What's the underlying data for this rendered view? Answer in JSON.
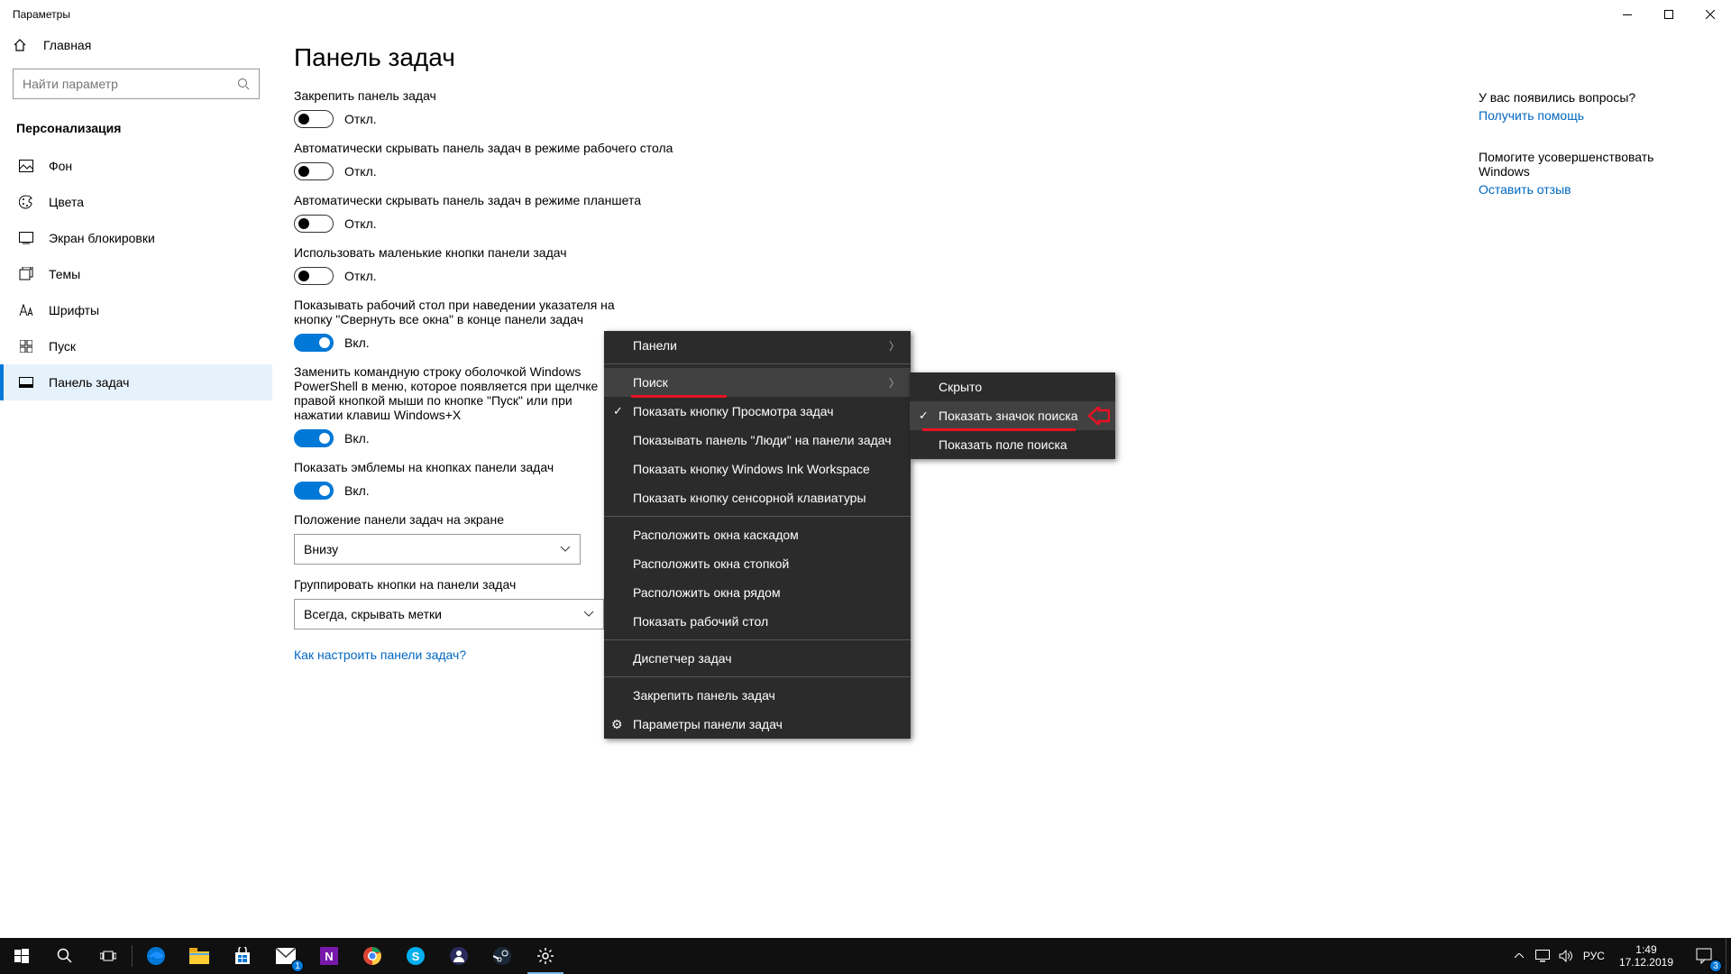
{
  "window": {
    "title": "Параметры"
  },
  "nav": {
    "home": "Главная",
    "search_placeholder": "Найти параметр",
    "section": "Персонализация",
    "items": [
      "Фон",
      "Цвета",
      "Экран блокировки",
      "Темы",
      "Шрифты",
      "Пуск",
      "Панель задач"
    ]
  },
  "page": {
    "title": "Панель задач",
    "off": "Откл.",
    "on": "Вкл.",
    "settings": [
      {
        "label": "Закрепить панель задач",
        "state": "off"
      },
      {
        "label": "Автоматически скрывать панель задач в режиме рабочего стола",
        "state": "off"
      },
      {
        "label": "Автоматически скрывать панель задач в режиме планшета",
        "state": "off"
      },
      {
        "label": "Использовать маленькие кнопки панели задач",
        "state": "off"
      },
      {
        "label": "Показывать рабочий стол при наведении указателя на кнопку \"Свернуть все окна\" в конце панели задач",
        "state": "on"
      },
      {
        "label": "Заменить командную строку оболочкой Windows PowerShell в меню, которое появляется при щелчке правой кнопкой мыши по кнопке \"Пуск\" или при нажатии клавиш Windows+X",
        "state": "on"
      },
      {
        "label": "Показать эмблемы на кнопках панели задач",
        "state": "on"
      }
    ],
    "position_label": "Положение панели задач на экране",
    "position_value": "Внизу",
    "group_label": "Группировать кнопки на панели задач",
    "group_value": "Всегда, скрывать метки",
    "help_link": "Как настроить панели задач?"
  },
  "rightcol": {
    "q1": "У вас появились вопросы?",
    "a1": "Получить помощь",
    "q2": "Помогите усовершенствовать Windows",
    "a2": "Оставить отзыв"
  },
  "context_menu": {
    "items": [
      {
        "label": "Панели",
        "submenu": true
      },
      {
        "label": "Поиск",
        "submenu": true,
        "hover": true,
        "redline": true
      },
      {
        "label": "Показать кнопку Просмотра задач",
        "checked": true
      },
      {
        "label": "Показывать панель \"Люди\" на панели задач"
      },
      {
        "label": "Показать кнопку Windows Ink Workspace"
      },
      {
        "label": "Показать кнопку сенсорной клавиатуры"
      },
      {
        "sep": true
      },
      {
        "label": "Расположить окна каскадом"
      },
      {
        "label": "Расположить окна стопкой"
      },
      {
        "label": "Расположить окна рядом"
      },
      {
        "label": "Показать рабочий стол"
      },
      {
        "sep": true
      },
      {
        "label": "Диспетчер задач"
      },
      {
        "sep": true
      },
      {
        "label": "Закрепить панель задач"
      },
      {
        "label": "Параметры панели задач",
        "gear": true
      }
    ],
    "submenu": [
      {
        "label": "Скрыто"
      },
      {
        "label": "Показать значок поиска",
        "checked": true,
        "hover": true,
        "redline": true,
        "arrow": true
      },
      {
        "label": "Показать поле поиска"
      }
    ]
  },
  "taskbar": {
    "lang": "РУС",
    "time": "1:49",
    "date": "17.12.2019",
    "notif_count": "3",
    "mail_badge": "1"
  }
}
